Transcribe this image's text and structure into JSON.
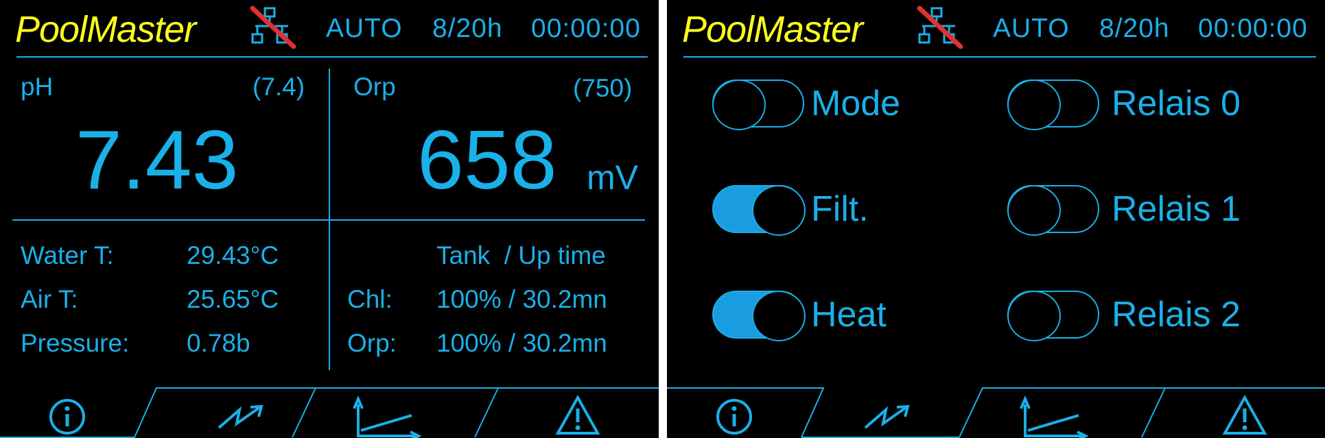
{
  "screens": [
    {
      "logo": "PoolMaster",
      "status": {
        "mode": "AUTO",
        "schedule": "8/20h",
        "clock": "00:00:00"
      },
      "ph": {
        "label": "pH",
        "setpoint": "(7.4)",
        "value": "7.43"
      },
      "orp": {
        "label": "Orp",
        "setpoint": "(750)",
        "value": "658",
        "unit": "mV"
      },
      "sensors": [
        {
          "label": "Water T:",
          "value": "29.43°C"
        },
        {
          "label": "Air T:",
          "value": "25.65°C"
        },
        {
          "label": "Pressure:",
          "value": "0.78b"
        }
      ],
      "tanks": {
        "header": "Tank  / Up time",
        "rows": [
          {
            "label": "Chl:",
            "value": "100% / 30.2mn"
          },
          {
            "label": "Orp:",
            "value": "100% / 30.2mn"
          }
        ]
      },
      "active_tab": "info"
    },
    {
      "logo": "PoolMaster",
      "status": {
        "mode": "AUTO",
        "schedule": "8/20h",
        "clock": "00:00:00"
      },
      "switches_left": [
        {
          "label": "Mode",
          "on": false
        },
        {
          "label": "Filt.",
          "on": true
        },
        {
          "label": "Heat",
          "on": true
        }
      ],
      "switches_right": [
        {
          "label": "Relais 0",
          "on": false
        },
        {
          "label": "Relais 1",
          "on": false
        },
        {
          "label": "Relais 2",
          "on": false
        }
      ],
      "active_tab": "control"
    }
  ],
  "tabs": [
    {
      "id": "info",
      "icon": "info-icon"
    },
    {
      "id": "control",
      "icon": "zigzag-control-icon"
    },
    {
      "id": "graph",
      "icon": "graph-axes-icon"
    },
    {
      "id": "alarm",
      "icon": "warning-icon"
    }
  ],
  "colors": {
    "accent": "#1ab0e8",
    "logo": "#ffff1e",
    "background": "#000000",
    "toggle_on": "#1a9ce0",
    "network_off": "#e03030"
  }
}
